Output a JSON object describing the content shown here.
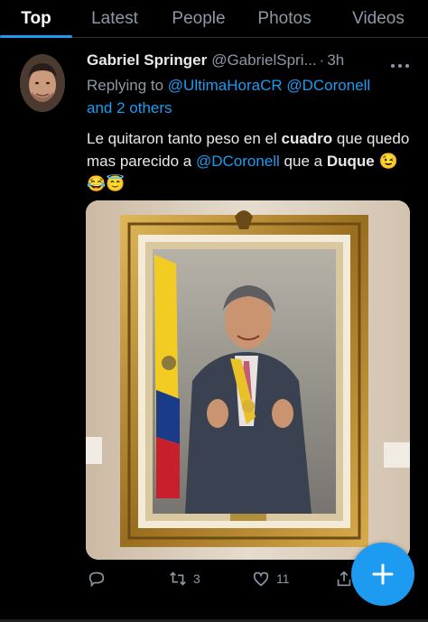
{
  "tabs": [
    {
      "label": "Top",
      "active": true
    },
    {
      "label": "Latest",
      "active": false
    },
    {
      "label": "People",
      "active": false
    },
    {
      "label": "Photos",
      "active": false
    },
    {
      "label": "Videos",
      "active": false
    }
  ],
  "tweet": {
    "author_name": "Gabriel Springer",
    "author_handle": "@GabrielSpri...",
    "separator": "·",
    "time": "3h",
    "more_icon": "more-horizontal-icon",
    "replying_prefix": "Replying to",
    "replying_users": [
      "@UltimaHoraCR",
      "@DCoronell"
    ],
    "replying_others": "and 2 others",
    "text": {
      "part1": "Le quitaron tanto peso en el ",
      "bold1": "cuadro",
      "part2": " que quedo mas parecido a ",
      "mention": "@DCoronell",
      "part3": " que a ",
      "bold2": "Duque",
      "emojis": "😉😂😇"
    },
    "actions": {
      "reply_icon": "reply-icon",
      "retweet_icon": "retweet-icon",
      "retweet_count": "3",
      "like_icon": "heart-icon",
      "like_count": "11",
      "share_icon": "share-icon"
    }
  },
  "fab": {
    "icon": "plus-icon"
  },
  "colors": {
    "accent": "#1d9bf0",
    "background": "#000000",
    "muted_text": "#8b98a5",
    "primary_text": "#e7e9ea"
  }
}
